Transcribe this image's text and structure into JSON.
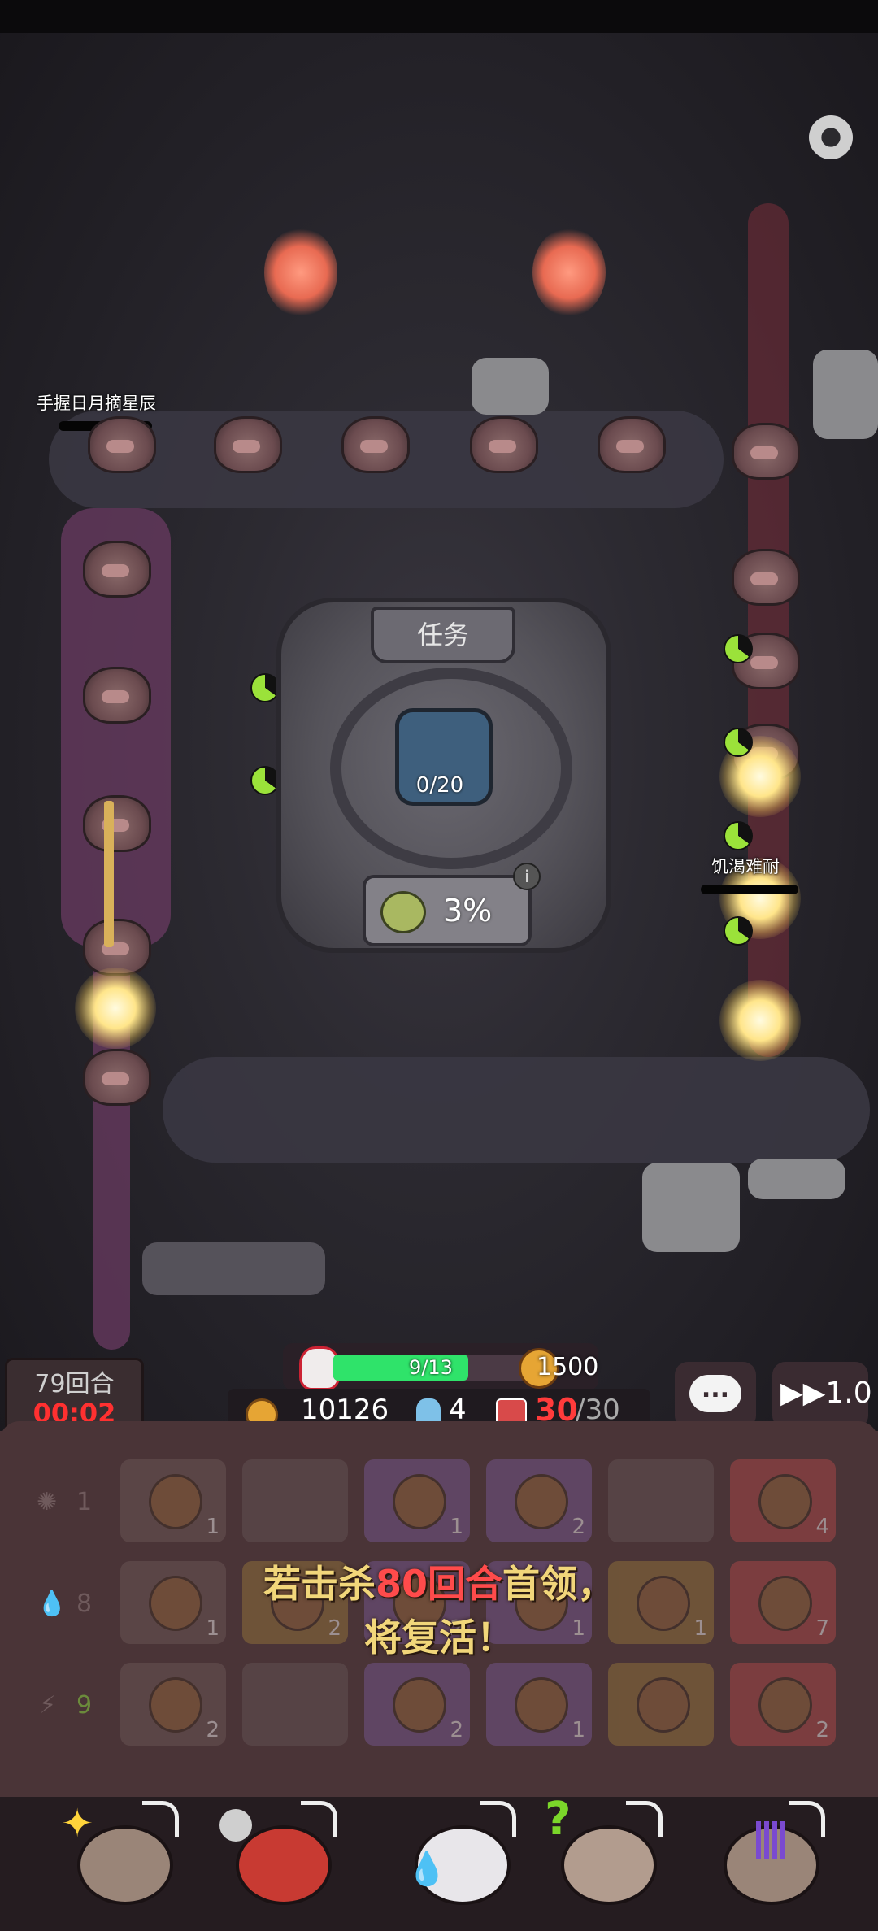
{
  "hud": {
    "round": "79回合",
    "timer": "00:02",
    "wave_progress": "9/13",
    "wave_ratio": 0.69,
    "boss_reward": "1500",
    "gold": "10126",
    "lives": "4",
    "cards_current": "30",
    "cards_max": "/30",
    "speed": "1.0",
    "chat_label": "..."
  },
  "map": {
    "player_name": "手握日月摘星辰",
    "enemy_label": "饥渴难耐",
    "task_title": "任务",
    "task_progress": "0/20",
    "bonus_percent": "3%"
  },
  "board": {
    "rows": [
      {
        "count": "1",
        "slots": [
          "1",
          "",
          "1",
          "2",
          "",
          "4"
        ]
      },
      {
        "count": "8",
        "slots": [
          "1",
          "2",
          "2",
          "1",
          "1",
          "7"
        ]
      },
      {
        "count": "9",
        "slots": [
          "2",
          "",
          "2",
          "1",
          "",
          "2"
        ]
      }
    ],
    "notice_line1_a": "若击杀",
    "notice_line1_red": "80回合",
    "notice_line1_b": "首领，",
    "notice_line2": "将复活！"
  },
  "heroes": [
    {
      "name": "hero-cross-star"
    },
    {
      "name": "hero-red-angry"
    },
    {
      "name": "hero-ice-crystal"
    },
    {
      "name": "hero-question-goggles"
    },
    {
      "name": "hero-purple-rain"
    }
  ],
  "colors": {
    "accent_green": "#2fe36a",
    "danger_red": "#ff3030",
    "notice_gold": "#f1d67a"
  }
}
